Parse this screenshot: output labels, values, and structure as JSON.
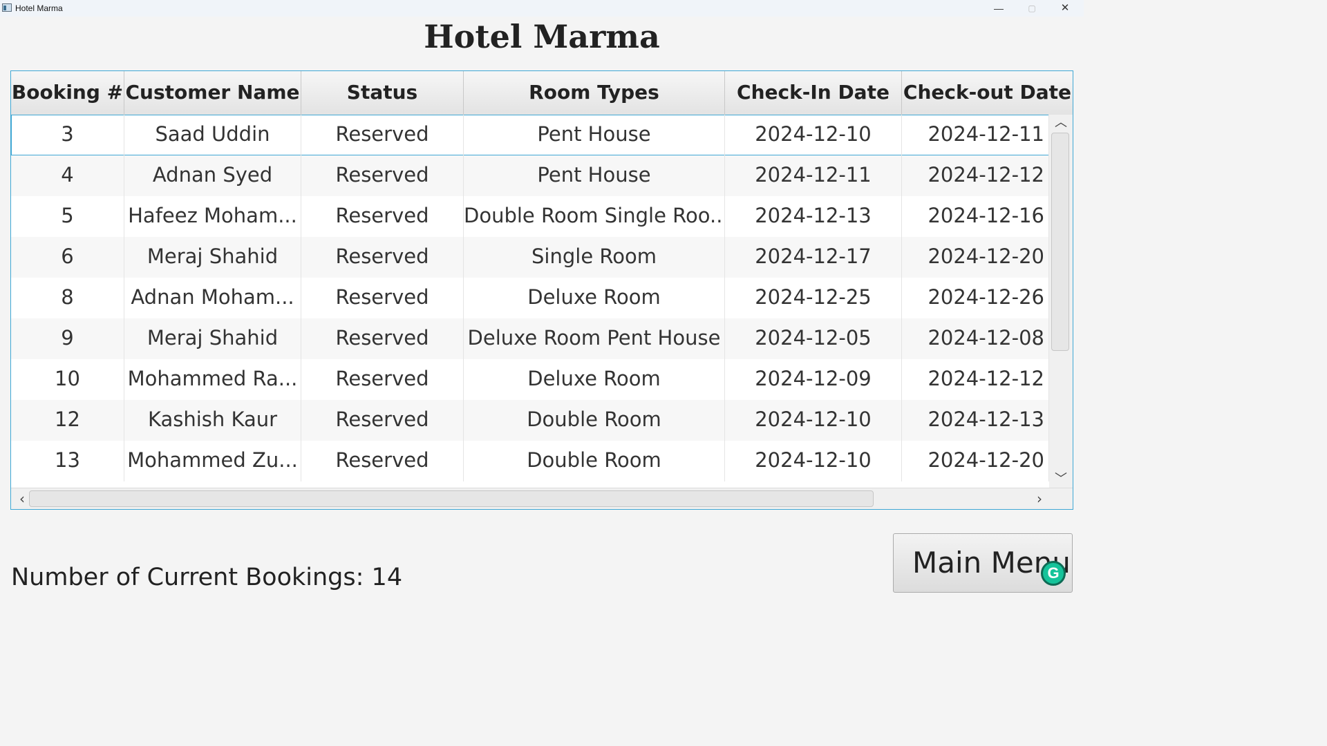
{
  "window": {
    "title": "Hotel Marma",
    "minimize_glyph": "—",
    "maximize_glyph": "▢",
    "close_glyph": "✕"
  },
  "page": {
    "title": "Hotel Marma"
  },
  "table": {
    "columns": [
      "Booking #",
      "Customer Name",
      "Status",
      "Room Types",
      "Check-In Date",
      "Check-out Date"
    ],
    "rows": [
      [
        "3",
        "Saad Uddin",
        "Reserved",
        "Pent House",
        "2024-12-10",
        "2024-12-11"
      ],
      [
        "4",
        "Adnan Syed",
        "Reserved",
        "Pent House",
        "2024-12-11",
        "2024-12-12"
      ],
      [
        "5",
        "Hafeez Moham...",
        "Reserved",
        "Double Room Single Roo...",
        "2024-12-13",
        "2024-12-16"
      ],
      [
        "6",
        "Meraj Shahid",
        "Reserved",
        "Single Room",
        "2024-12-17",
        "2024-12-20"
      ],
      [
        "8",
        "Adnan Moham...",
        "Reserved",
        "Deluxe Room",
        "2024-12-25",
        "2024-12-26"
      ],
      [
        "9",
        "Meraj Shahid",
        "Reserved",
        "Deluxe Room Pent House",
        "2024-12-05",
        "2024-12-08"
      ],
      [
        "10",
        "Mohammed Ra...",
        "Reserved",
        "Deluxe Room",
        "2024-12-09",
        "2024-12-12"
      ],
      [
        "12",
        "Kashish Kaur",
        "Reserved",
        "Double Room",
        "2024-12-10",
        "2024-12-13"
      ],
      [
        "13",
        "Mohammed Zu...",
        "Reserved",
        "Double Room",
        "2024-12-10",
        "2024-12-20"
      ]
    ],
    "selected_row_index": 0
  },
  "footer": {
    "count_label": "Number of Current Bookings: 14",
    "main_menu_label": "Main Menu"
  },
  "icons": {
    "scroll_up": "chevron-up-icon",
    "scroll_down": "chevron-down-icon",
    "scroll_left": "chevron-left-icon",
    "scroll_right": "chevron-right-icon",
    "grammarly": "grammarly-icon"
  },
  "colors": {
    "accent_border": "#3ea7d4",
    "grammarly_green": "#15c39a"
  }
}
